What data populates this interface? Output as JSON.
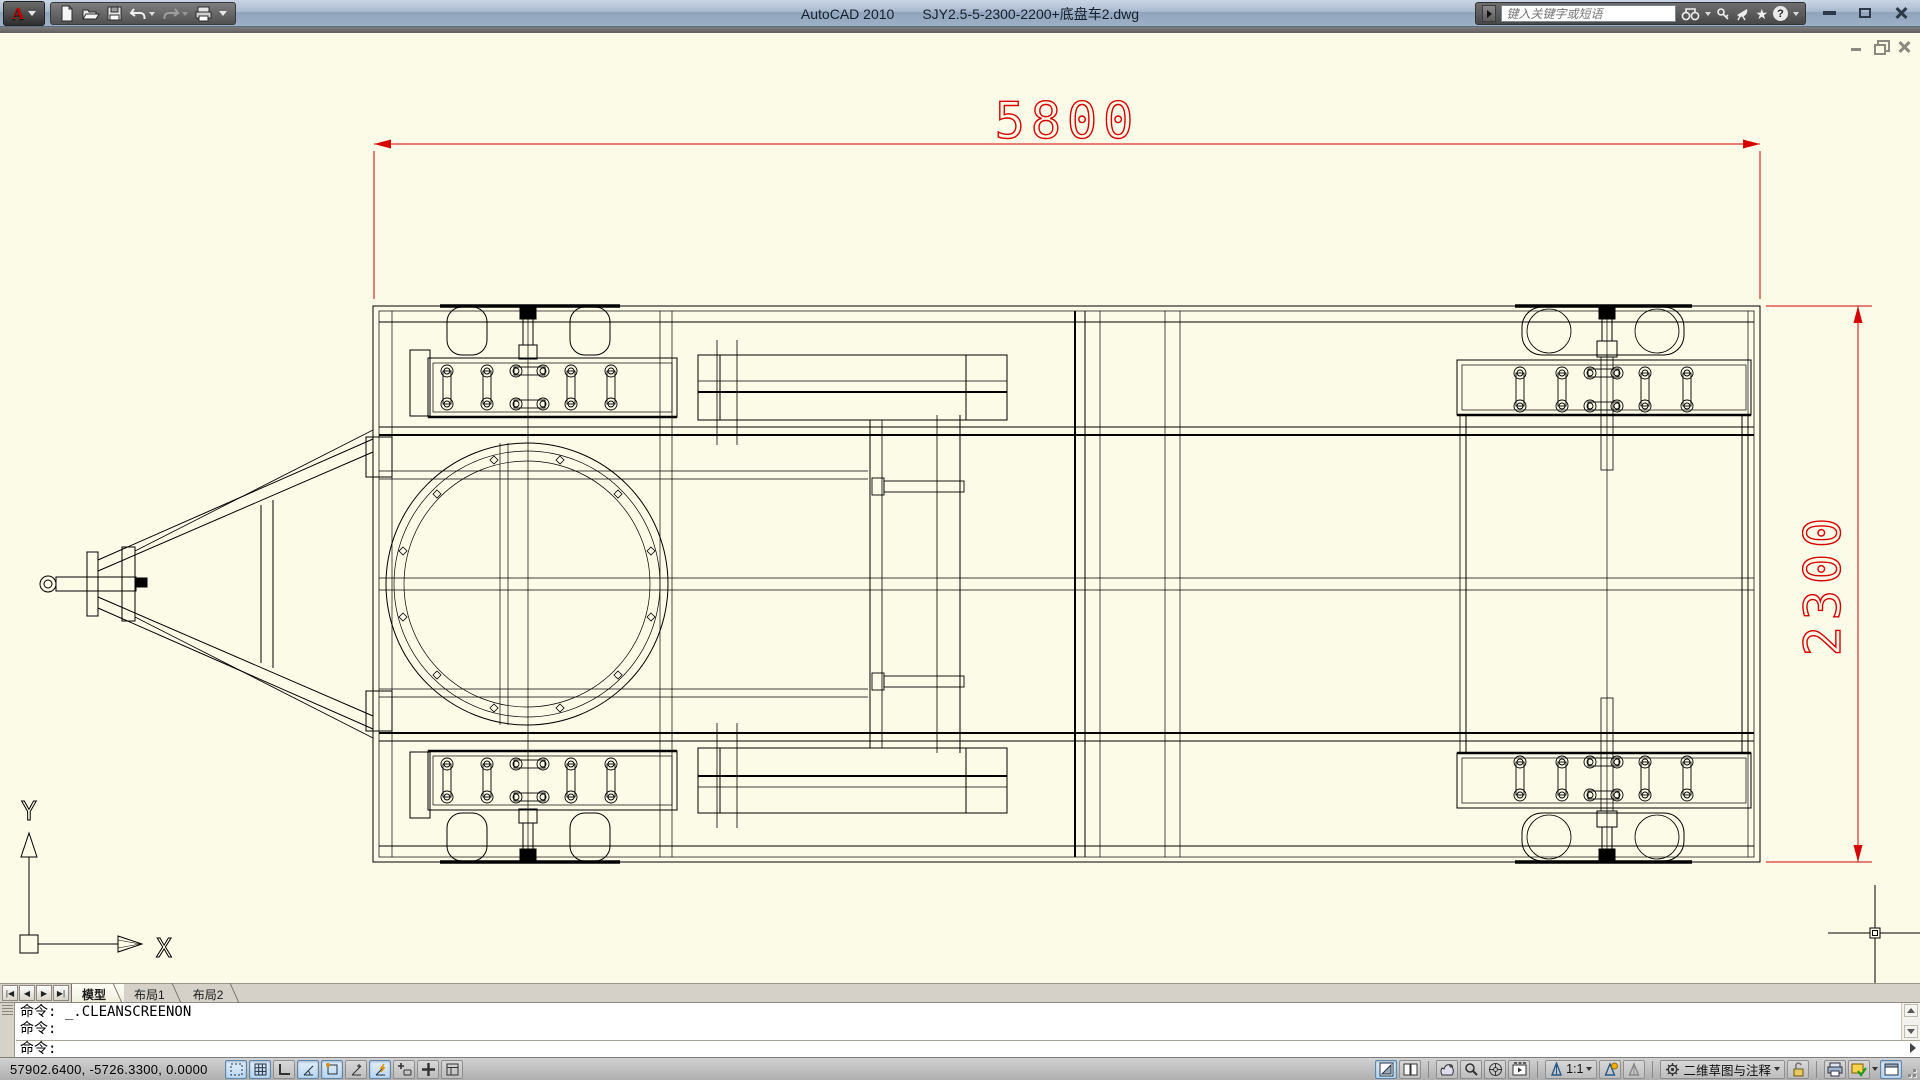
{
  "titlebar": {
    "app_title": "AutoCAD 2010",
    "doc_title": "SJY2.5-5-2300-2200+底盘车2.dwg",
    "logo_letter": "A"
  },
  "infocenter": {
    "search_placeholder": "键入关键字或短语",
    "star_glyph": "★",
    "help_glyph": "?"
  },
  "drawing": {
    "background_color": "#fcfbe8",
    "line_color": "#000000",
    "dimension_color": "#d60000",
    "dim_length": "5800",
    "dim_width": "2300",
    "ucs_x": "X",
    "ucs_y": "Y"
  },
  "tabs": {
    "model": "模型",
    "layout1": "布局1",
    "layout2": "布局2"
  },
  "command": {
    "history_line1": "命令: _.CLEANSCREENON",
    "history_line2": "命令:",
    "prompt": "命令:"
  },
  "statusbar": {
    "coordinates": "57902.6400, -5726.3300, 0.0000",
    "annotation_scale": "1:1",
    "workspace": "二维草图与注释",
    "toggles": [
      {
        "name": "snap",
        "on": true
      },
      {
        "name": "grid",
        "on": true
      },
      {
        "name": "ortho",
        "on": false
      },
      {
        "name": "polar",
        "on": true
      },
      {
        "name": "osnap",
        "on": true
      },
      {
        "name": "otrack",
        "on": false
      },
      {
        "name": "ducs",
        "on": true
      },
      {
        "name": "dyn",
        "on": false
      },
      {
        "name": "lwt",
        "on": false
      },
      {
        "name": "qp",
        "on": false
      }
    ]
  }
}
